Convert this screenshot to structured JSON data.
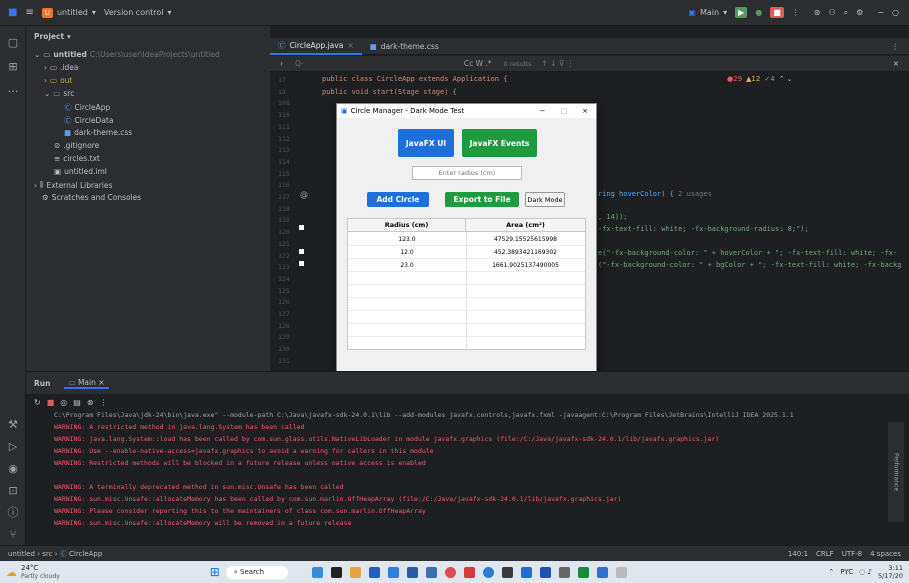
{
  "titlebar": {
    "project": "untitled",
    "vcs": "Version control",
    "branch": "Main"
  },
  "project_panel": {
    "title": "Project",
    "items": [
      {
        "label": "untitled",
        "path": "C:\\Users\\user\\IdeaProjects\\untitled"
      },
      {
        "label": ".idea"
      },
      {
        "label": "out"
      },
      {
        "label": "src"
      },
      {
        "label": "CircleApp"
      },
      {
        "label": "CircleData"
      },
      {
        "label": "dark-theme.css"
      },
      {
        "label": ".gitignore"
      },
      {
        "label": "circles.txt"
      },
      {
        "label": "untitled.iml"
      },
      {
        "label": "External Libraries"
      },
      {
        "label": "Scratches and Consoles"
      }
    ]
  },
  "editor": {
    "tabs": [
      "CircleApp.java",
      "dark-theme.css"
    ],
    "search": {
      "placeholder": "Q-",
      "results": "0 results",
      "opts": "Cc W .*"
    },
    "inspections": {
      "errors": "29",
      "warnings": "12",
      "weak": "4"
    },
    "lines": [
      "17",
      "18",
      "108",
      "110",
      "111",
      "112",
      "113",
      "114",
      "115",
      "116",
      "117",
      "118",
      "119",
      "120",
      "121",
      "122",
      "123",
      "124",
      "125",
      "126",
      "127",
      "128",
      "129",
      "130",
      "131"
    ],
    "code_top1": "public class CircleApp extends Application {",
    "code_top2": "    public void start(Stage stage) {",
    "code_r1": "ring hoverColor) {",
    "code_r1_hint": "2 usages",
    "code_r2": ", 14));",
    "code_r3": "-fx-text-fill: white; -fx-background-radius: 8;\");",
    "code_r4": "e(\"-fx-background-color: \" + hoverColor + \"; -fx-text-fill: white; -fx-",
    "code_r5": "(\"-fx-background-color: \" + bgColor + \"; -fx-text-fill: white; -fx-backg"
  },
  "dialog": {
    "title": "Circle Manager - Dark Mode Test",
    "btn_ui": "JavaFX UI",
    "btn_events": "JavaFX Events",
    "radius_placeholder": "Enter radius (cm)",
    "btn_add": "Add Circle",
    "btn_export": "Export to File",
    "btn_dark": "Dark Mode",
    "table": {
      "headers": [
        "Radius (cm)",
        "Area (cm²)"
      ],
      "rows": [
        [
          "123.0",
          "47529.15525615998"
        ],
        [
          "12.0",
          "452.3893421169302"
        ],
        [
          "23.0",
          "1661.9025137490005"
        ]
      ]
    }
  },
  "run": {
    "tab": "Run",
    "config": "Main",
    "lines": [
      "C:\\Program Files\\Java\\jdk-24\\bin\\java.exe\" --module-path C:\\Java\\javafx-sdk-24.0.1\\lib --add-modules javafx.controls,javafx.fxml -javaagent:C:\\Program Files\\JetBrains\\IntelliJ IDEA 2025.1.1",
      "WARNING: A restricted method in java.lang.System has been called",
      "WARNING: java.lang.System::load has been called by com.sun.glass.utils.NativeLibLoader in module javafx.graphics (file:/C:/Java/javafx-sdk-24.0.1/lib/javafx.graphics.jar)",
      "WARNING: Use --enable-native-access=javafx.graphics to avoid a warning for callers in this module",
      "WARNING: Restricted methods will be blocked in a future release unless native access is enabled",
      "",
      "WARNING: A terminally deprecated method in sun.misc.Unsafe has been called",
      "WARNING: sun.misc.Unsafe::allocateMemory has been called by com.sun.marlin.OffHeapArray (file:/C:/Java/javafx-sdk-24.0.1/lib/javafx.graphics.jar)",
      "WARNING: Please consider reporting this to the maintainers of class com.sun.marlin.OffHeapArray",
      "WARNING: sun.misc.Unsafe::allocateMemory will be removed in a future release"
    ]
  },
  "statusbar": {
    "crumbs": [
      "untitled",
      "src",
      "CircleApp"
    ],
    "pos": "140:1",
    "eol": "CRLF",
    "enc": "UTF-8",
    "indent": "4 spaces"
  },
  "taskbar": {
    "temp": "24°C",
    "weather": "Partly cloudy",
    "search": "Search",
    "lang": "PYC",
    "time": "3:11",
    "date": "5/17/20"
  }
}
